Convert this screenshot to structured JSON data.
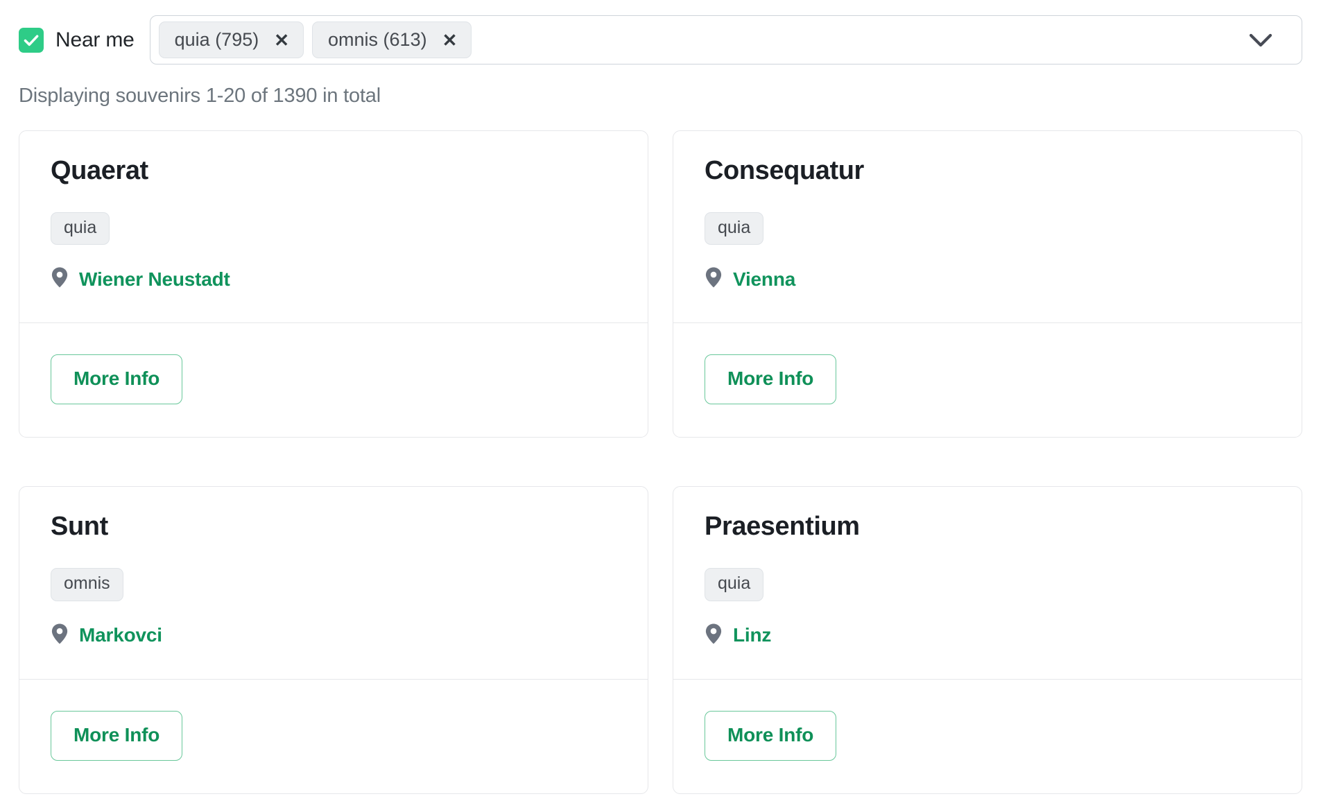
{
  "filter_bar": {
    "near_me": {
      "label": "Near me",
      "checked": true,
      "check_color": "#2ecc87",
      "icon": "check-icon"
    },
    "select": {
      "chevron_icon": "chevron-down-icon",
      "tags": [
        {
          "label": "quia (795)",
          "remove_icon": "close-icon",
          "remove_glyph": "✕"
        },
        {
          "label": "omnis (613)",
          "remove_icon": "close-icon",
          "remove_glyph": "✕"
        }
      ]
    }
  },
  "results": {
    "count_text": "Displaying souvenirs 1-20 of 1390 in total",
    "cards": [
      {
        "title": "Quaerat",
        "badge": "quia",
        "location": "Wiener Neustadt",
        "location_icon": "map-pin-icon",
        "button_label": "More Info"
      },
      {
        "title": "Consequatur",
        "badge": "quia",
        "location": "Vienna",
        "location_icon": "map-pin-icon",
        "button_label": "More Info"
      },
      {
        "title": "Sunt",
        "badge": "omnis",
        "location": "Markovci",
        "location_icon": "map-pin-icon",
        "button_label": "More Info"
      },
      {
        "title": "Praesentium",
        "badge": "quia",
        "location": "Linz",
        "location_icon": "map-pin-icon",
        "button_label": "More Info"
      }
    ]
  },
  "colors": {
    "accent_green": "#10935c",
    "checkbox_green": "#2ecc87",
    "button_border_green": "#68c79a",
    "muted_text": "#6c757d",
    "title_text": "#1b1f25",
    "border": "#e6e7ea",
    "badge_bg": "#eef0f2"
  }
}
